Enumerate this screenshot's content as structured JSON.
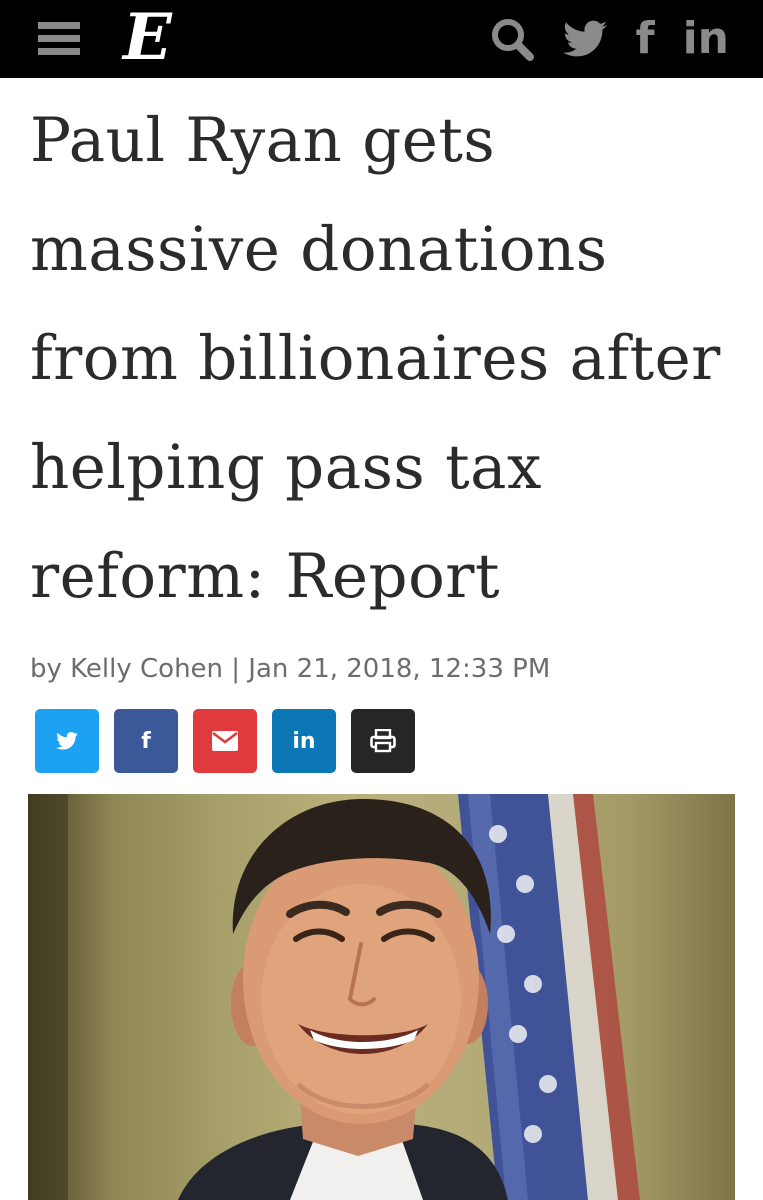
{
  "header": {
    "logo": "E",
    "menu_icon": "hamburger-menu-icon",
    "icons": [
      "search-icon",
      "twitter-icon",
      "facebook-icon",
      "linkedin-icon"
    ],
    "facebook_glyph": "f",
    "linkedin_glyph": "in",
    "background": "#000000",
    "icon_color": "#8a8a8a"
  },
  "article": {
    "headline": "Paul Ryan gets massive donations from billionaires after helping pass tax reform: Report",
    "byline": "by Kelly Cohen | Jan 21, 2018, 12:33 PM"
  },
  "share": {
    "buttons": [
      {
        "icon": "twitter-icon",
        "color": "#1da1f2"
      },
      {
        "icon": "facebook-icon",
        "color": "#3b5998",
        "glyph": "f"
      },
      {
        "icon": "email-icon",
        "color": "#e0393e"
      },
      {
        "icon": "linkedin-icon",
        "color": "#0b78b5",
        "glyph": "in"
      },
      {
        "icon": "print-icon",
        "color": "#262626"
      }
    ]
  },
  "image": {
    "subject": "photo-of-smiling-man-in-suit-before-american-flag"
  }
}
